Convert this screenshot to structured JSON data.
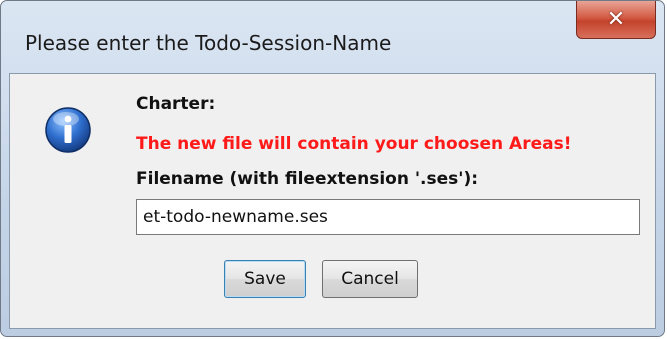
{
  "window": {
    "title": "Please enter the Todo-Session-Name",
    "close_icon": "close-icon"
  },
  "dialog": {
    "icon": "info-icon",
    "charter_label": "Charter:",
    "warning": "The new file will contain your choosen Areas!",
    "filename_label": "Filename (with fileextension '.ses'):",
    "filename_value": "et-todo-newname.ses"
  },
  "buttons": {
    "save_label": "Save",
    "cancel_label": "Cancel"
  },
  "colors": {
    "warning": "#ff1a1a",
    "close_button": "#c4432c",
    "info_icon": "#1f5fb4"
  }
}
